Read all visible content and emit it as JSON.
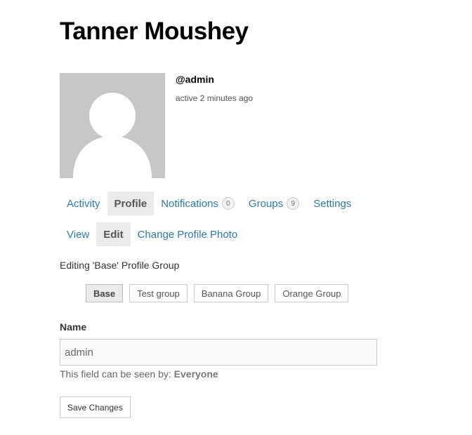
{
  "profile": {
    "name": "Tanner Moushey",
    "username": "@admin",
    "last_active": "active 2 minutes ago",
    "avatar_icon": "default-avatar-silhouette"
  },
  "primary_nav": {
    "items": [
      {
        "label": "Activity"
      },
      {
        "label": "Profile",
        "current": true
      },
      {
        "label": "Notifications",
        "count": "0"
      },
      {
        "label": "Groups",
        "count": "9"
      },
      {
        "label": "Settings"
      }
    ]
  },
  "secondary_nav": {
    "items": [
      {
        "label": "View"
      },
      {
        "label": "Edit",
        "current": true
      },
      {
        "label": "Change Profile Photo"
      }
    ]
  },
  "edit_form": {
    "editing_label": "Editing 'Base' Profile Group",
    "group_tabs": [
      {
        "label": "Base",
        "current": true
      },
      {
        "label": "Test group"
      },
      {
        "label": "Banana Group"
      },
      {
        "label": "Orange Group"
      }
    ],
    "name_field": {
      "label": "Name",
      "value": "admin"
    },
    "visibility_prefix": "This field can be seen by:",
    "visibility_level": "Everyone",
    "save_label": "Save Changes"
  },
  "colors": {
    "link": "#2a7ab8",
    "current_tab_bg": "#eaeaea",
    "avatar_bg": "#c6c6c6"
  }
}
